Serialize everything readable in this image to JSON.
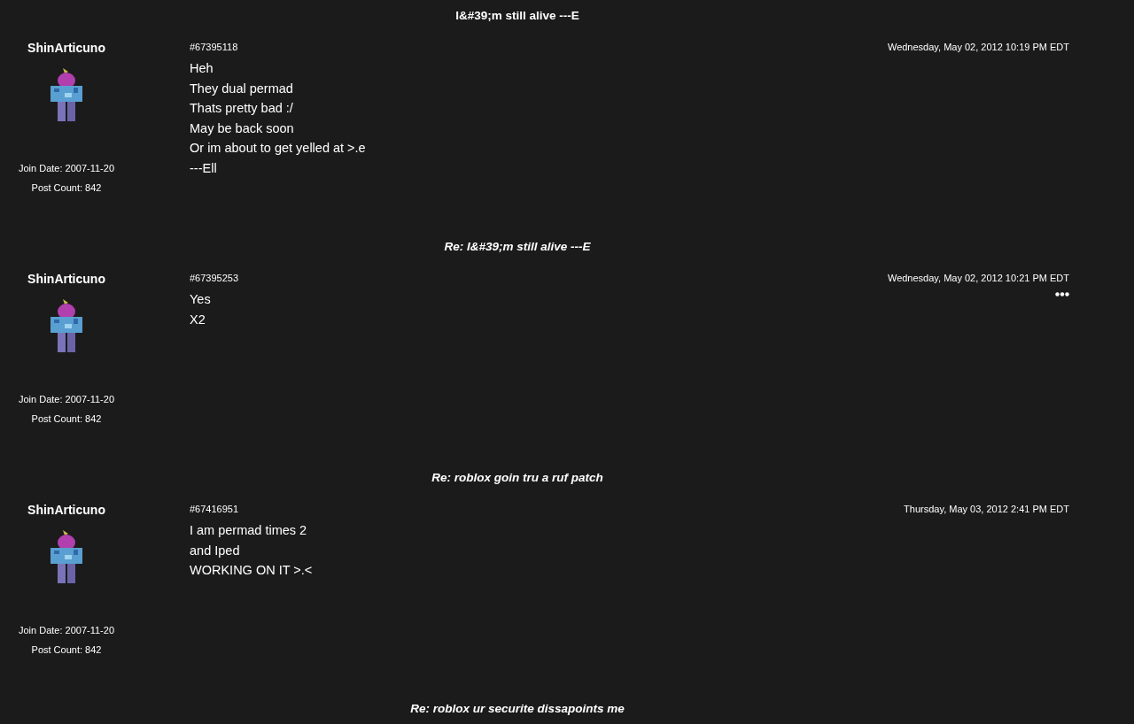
{
  "posts": [
    {
      "title": "I&#39;m still alive ---E",
      "kind": "thread",
      "author": "ShinArticuno",
      "join_date": "Join Date: 2007-11-20",
      "post_count": "Post Count: 842",
      "post_id": "#67395118",
      "timestamp": "Wednesday, May 02, 2012 10:19 PM EDT",
      "has_menu": false,
      "lines": [
        "Heh",
        "They dual permad",
        "Thats pretty bad :/",
        "May be back soon",
        "Or im about to get yelled at >.e",
        "---Ell"
      ]
    },
    {
      "title": "Re: I&#39;m still alive ---E",
      "kind": "reply",
      "author": "ShinArticuno",
      "join_date": "Join Date: 2007-11-20",
      "post_count": "Post Count: 842",
      "post_id": "#67395253",
      "timestamp": "Wednesday, May 02, 2012 10:21 PM EDT",
      "has_menu": true,
      "lines": [
        "Yes",
        "X2"
      ]
    },
    {
      "title": "Re: roblox goin tru a ruf patch",
      "kind": "reply",
      "author": "ShinArticuno",
      "join_date": "Join Date: 2007-11-20",
      "post_count": "Post Count: 842",
      "post_id": "#67416951",
      "timestamp": "Thursday, May 03, 2012 2:41 PM EDT",
      "has_menu": false,
      "lines": [
        "I am permad times 2",
        "and Iped",
        "WORKING ON IT >.<"
      ]
    }
  ],
  "next_title": {
    "title": "Re: roblox ur securite dissapoints me",
    "kind": "reply"
  }
}
